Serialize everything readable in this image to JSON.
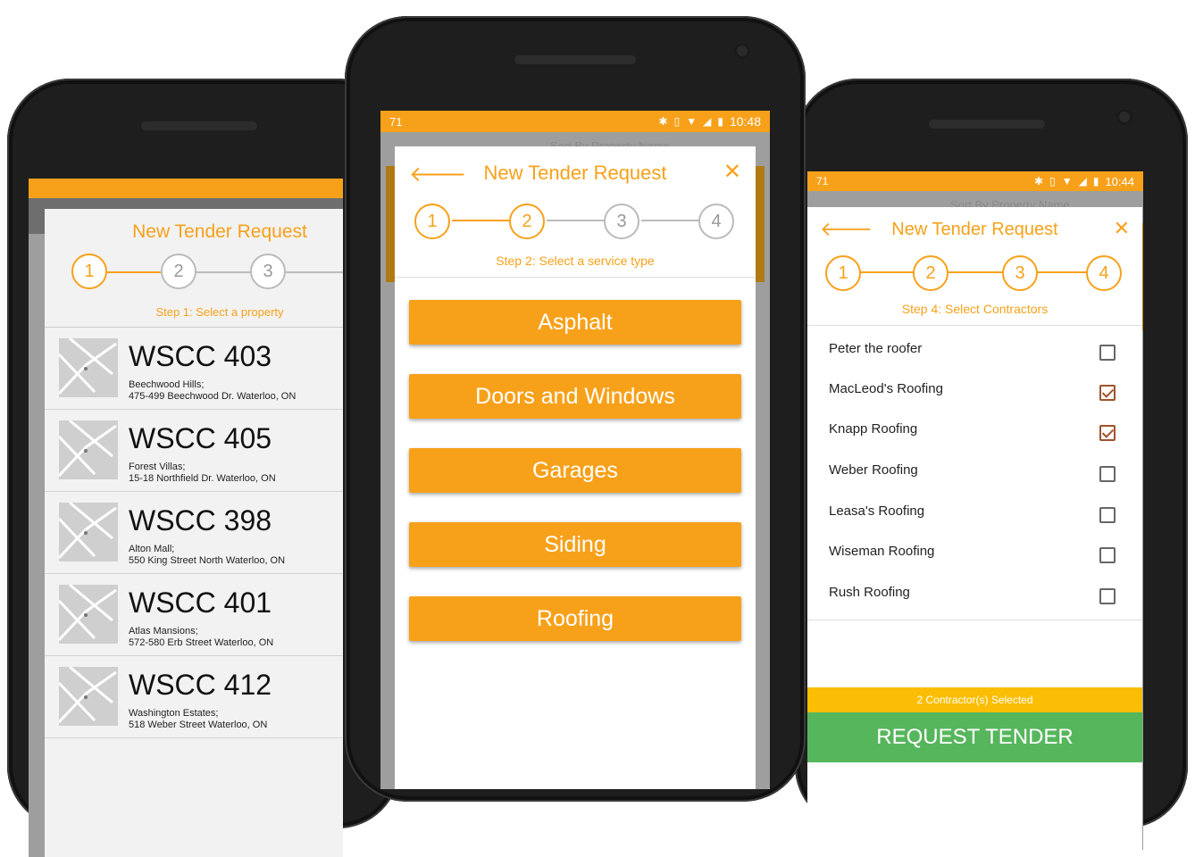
{
  "left": {
    "title": "New Tender Request",
    "steps": [
      "1",
      "2",
      "3"
    ],
    "step_label": "Step 1: Select a property",
    "properties": [
      {
        "name": "WSCC 403",
        "area": "Beechwood Hills;",
        "address": "475-499 Beechwood Dr. Waterloo, ON"
      },
      {
        "name": "WSCC 405",
        "area": "Forest Villas;",
        "address": "15-18 Northfield Dr. Waterloo, ON"
      },
      {
        "name": "WSCC 398",
        "area": "Alton Mall;",
        "address": "550 King Street North Waterloo, ON"
      },
      {
        "name": "WSCC 401",
        "area": "Atlas Mansions;",
        "address": "572-580 Erb Street Waterloo, ON"
      },
      {
        "name": "WSCC 412",
        "area": "Washington Estates;",
        "address": "518 Weber Street Waterloo, ON"
      }
    ]
  },
  "mid": {
    "status": {
      "left": "71",
      "time": "10:48"
    },
    "sort_label": "Sort By Property Name",
    "title": "New Tender Request",
    "steps": [
      "1",
      "2",
      "3",
      "4"
    ],
    "step_label": "Step 2: Select a service type",
    "services": [
      "Asphalt",
      "Doors and Windows",
      "Garages",
      "Siding",
      "Roofing"
    ]
  },
  "right": {
    "status": {
      "left": "71",
      "time": "10:44"
    },
    "sort_label": "Sort By Property Name",
    "title": "New Tender Request",
    "steps": [
      "1",
      "2",
      "3",
      "4"
    ],
    "step_label": "Step 4: Select Contractors",
    "contractors": [
      {
        "name": "Peter the roofer",
        "checked": false
      },
      {
        "name": "MacLeod's Roofing",
        "checked": true
      },
      {
        "name": "Knapp Roofing",
        "checked": true
      },
      {
        "name": "Weber Roofing",
        "checked": false
      },
      {
        "name": "Leasa's Roofing",
        "checked": false
      },
      {
        "name": "Wiseman Roofing",
        "checked": false
      },
      {
        "name": "Rush Roofing",
        "checked": false
      }
    ],
    "summary": "2 Contractor(s) Selected",
    "request_button": "REQUEST TENDER"
  },
  "colors": {
    "accent": "#f7a11a",
    "summary": "#fbbe05",
    "request": "#56b65c",
    "checked": "#a0522d"
  }
}
